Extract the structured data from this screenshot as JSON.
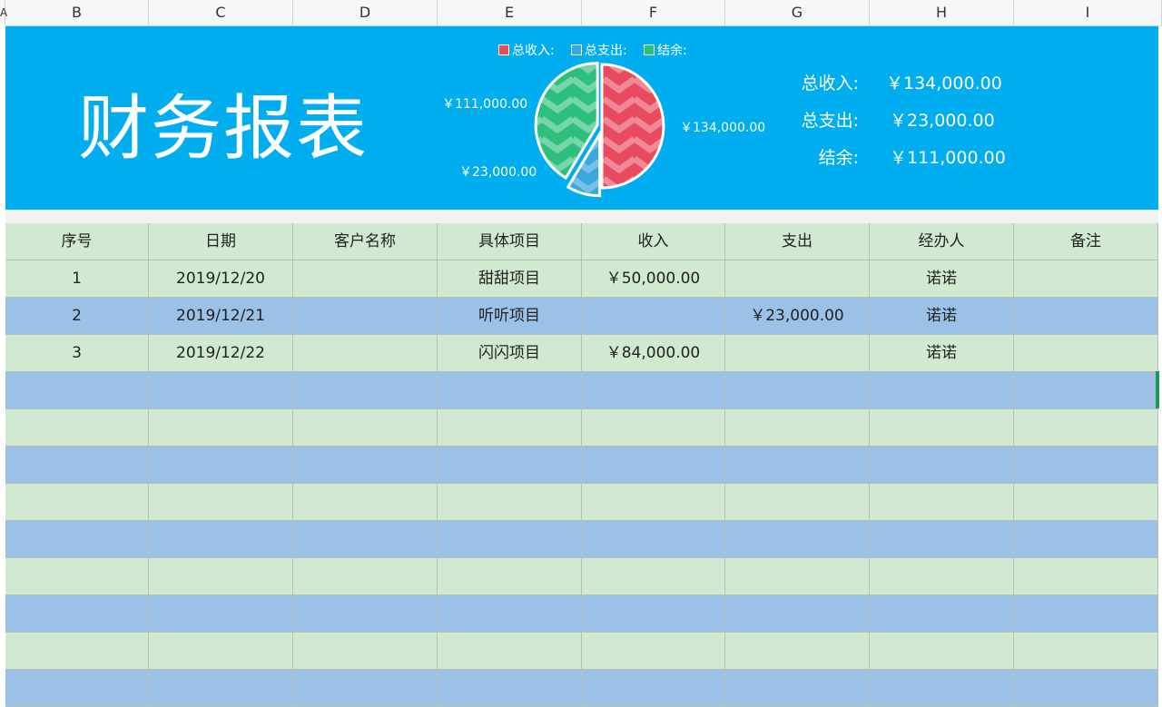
{
  "columns": [
    "A",
    "B",
    "C",
    "D",
    "E",
    "F",
    "G",
    "H",
    "I"
  ],
  "banner": {
    "title": "财务报表",
    "background": "#00adef",
    "legend": [
      {
        "label": "总收入:",
        "color": "#e84a5f"
      },
      {
        "label": "总支出:",
        "color": "#3aa8dd"
      },
      {
        "label": "结余:",
        "color": "#2ebf7c"
      }
    ],
    "pie_labels": {
      "income": "￥134,000.00",
      "expense": "￥23,000.00",
      "balance": "￥111,000.00"
    },
    "summary": [
      {
        "label": "总收入:",
        "value": "￥134,000.00"
      },
      {
        "label": "总支出:",
        "value": "￥23,000.00"
      },
      {
        "label": "结余:",
        "value": "￥111,000.00"
      }
    ]
  },
  "chart_data": {
    "type": "pie",
    "categories": [
      "总收入",
      "总支出",
      "结余"
    ],
    "values": [
      134000,
      23000,
      111000
    ],
    "colors": [
      "#e84a5f",
      "#3aa8dd",
      "#2ebf7c"
    ]
  },
  "table": {
    "headers": [
      "序号",
      "日期",
      "客户名称",
      "具体项目",
      "收入",
      "支出",
      "经办人",
      "备注"
    ],
    "rows": [
      [
        "1",
        "2019/12/20",
        "",
        "甜甜项目",
        "￥50,000.00",
        "",
        "诺诺",
        ""
      ],
      [
        "2",
        "2019/12/21",
        "",
        "听听项目",
        "",
        "￥23,000.00",
        "诺诺",
        ""
      ],
      [
        "3",
        "2019/12/22",
        "",
        "闪闪项目",
        "￥84,000.00",
        "",
        "诺诺",
        ""
      ],
      [
        "",
        "",
        "",
        "",
        "",
        "",
        "",
        ""
      ],
      [
        "",
        "",
        "",
        "",
        "",
        "",
        "",
        ""
      ],
      [
        "",
        "",
        "",
        "",
        "",
        "",
        "",
        ""
      ],
      [
        "",
        "",
        "",
        "",
        "",
        "",
        "",
        ""
      ],
      [
        "",
        "",
        "",
        "",
        "",
        "",
        "",
        ""
      ],
      [
        "",
        "",
        "",
        "",
        "",
        "",
        "",
        ""
      ],
      [
        "",
        "",
        "",
        "",
        "",
        "",
        "",
        ""
      ],
      [
        "",
        "",
        "",
        "",
        "",
        "",
        "",
        ""
      ],
      [
        "",
        "",
        "",
        "",
        "",
        "",
        "",
        ""
      ]
    ],
    "row_colors": [
      "#d0e9d0",
      "#9cc1e6"
    ]
  }
}
